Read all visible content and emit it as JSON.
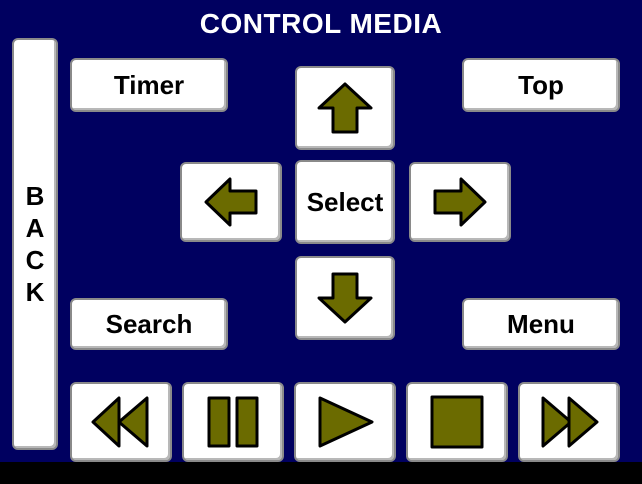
{
  "title": "CONTROL MEDIA",
  "back": {
    "label": "BACK",
    "letters": [
      "B",
      "A",
      "C",
      "K"
    ]
  },
  "buttons": {
    "timer": "Timer",
    "top": "Top",
    "select": "Select",
    "search": "Search",
    "menu": "Menu"
  },
  "icons": {
    "up": "arrow-up-icon",
    "down": "arrow-down-icon",
    "left": "arrow-left-icon",
    "right": "arrow-right-icon",
    "rewind": "rewind-icon",
    "pause": "pause-icon",
    "play": "play-icon",
    "stop": "stop-icon",
    "fast_forward": "fast-forward-icon"
  },
  "colors": {
    "background": "#000060",
    "icon_fill": "#6b6b00",
    "button": "#ffffff",
    "text": "#ffffff"
  }
}
